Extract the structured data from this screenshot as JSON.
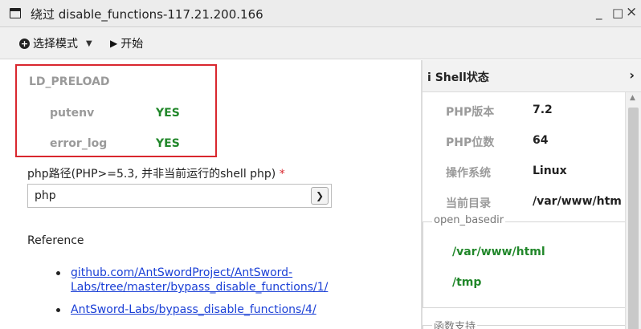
{
  "window": {
    "icon": "window-icon",
    "title": "绕过 disable_functions-117.21.200.166",
    "controls": {
      "minimize": "_",
      "maximize": "□",
      "close": "×"
    }
  },
  "toolbar": {
    "select_mode_label": "选择模式",
    "start_label": "开始"
  },
  "ld_preload": {
    "title": "LD_PRELOAD",
    "functions": [
      {
        "name": "putenv",
        "status": "YES"
      },
      {
        "name": "error_log",
        "status": "YES"
      }
    ]
  },
  "php_path": {
    "label": "php路径(PHP>=5.3, 并非当前运行的shell php)",
    "required_mark": "*",
    "value": "php"
  },
  "reference": {
    "label": "Reference",
    "links": [
      "github.com/AntSwordProject/AntSword-Labs/tree/master/bypass_disable_functions/1/",
      "AntSword-Labs/bypass_disable_functions/4/"
    ]
  },
  "shell_status": {
    "title": "Shell状态",
    "info": [
      {
        "key": "PHP版本",
        "value": "7.2"
      },
      {
        "key": "PHP位数",
        "value": "64"
      },
      {
        "key": "操作系统",
        "value": "Linux"
      },
      {
        "key": "当前目录",
        "value": "/var/www/htm"
      }
    ],
    "open_basedir_legend": "open_basedir",
    "open_basedir_dirs": [
      "/var/www/html",
      "/tmp"
    ],
    "functions_legend": "函数支持"
  },
  "colors": {
    "highlight_border": "#d9272e",
    "yes_green": "#21872a",
    "link_blue": "#1a3fd6",
    "muted_gray": "#9a9a9a"
  }
}
